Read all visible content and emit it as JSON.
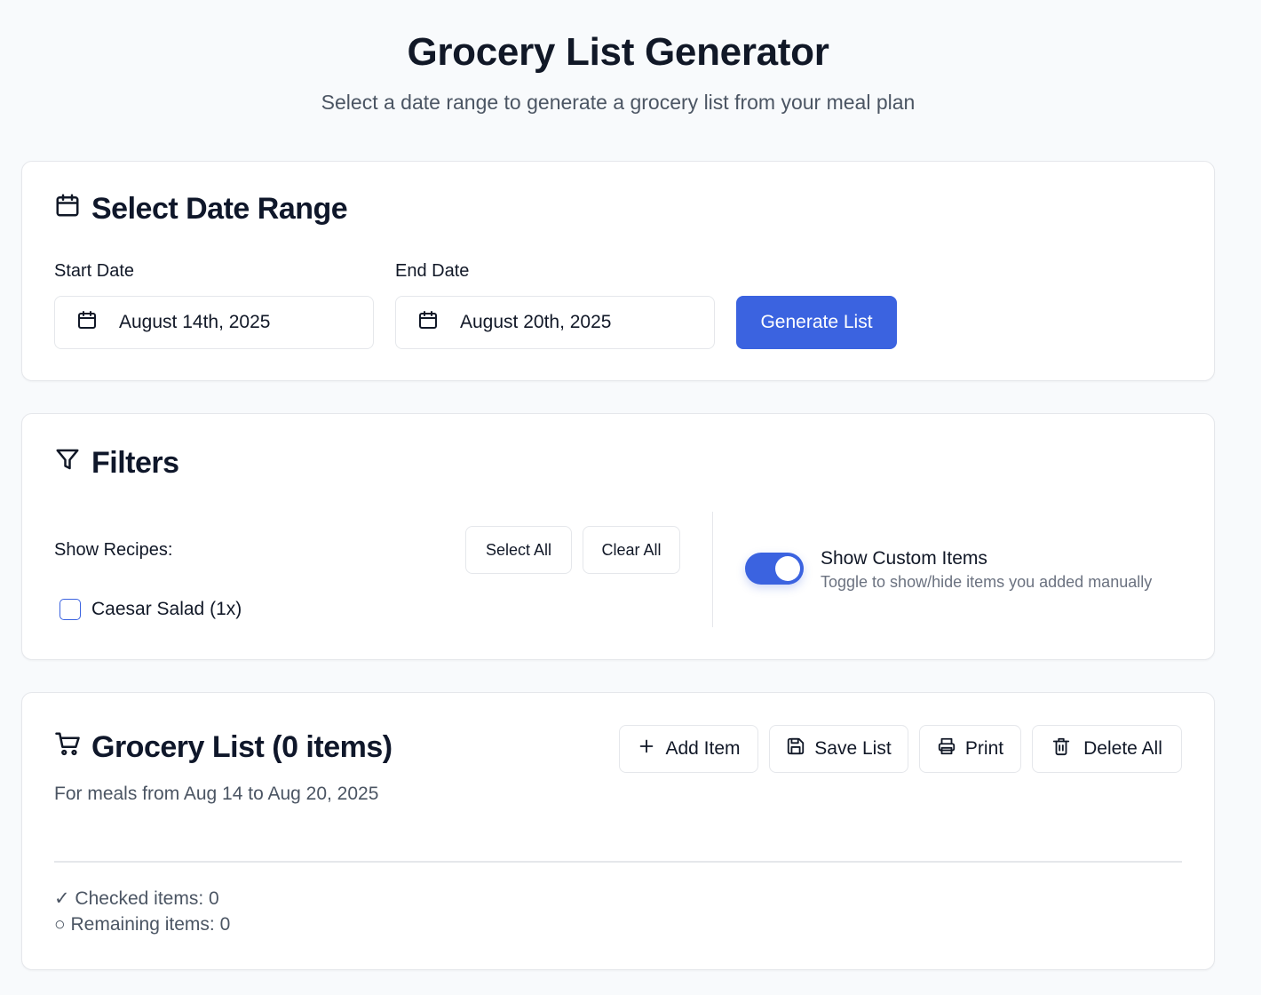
{
  "header": {
    "title": "Grocery List Generator",
    "subtitle": "Select a date range to generate a grocery list from your meal plan"
  },
  "date_range": {
    "title": "Select Date Range",
    "start_label": "Start Date",
    "start_value": "August 14th, 2025",
    "end_label": "End Date",
    "end_value": "August 20th, 2025",
    "generate_label": "Generate List"
  },
  "filters": {
    "title": "Filters",
    "show_recipes_label": "Show Recipes:",
    "select_all_label": "Select All",
    "clear_all_label": "Clear All",
    "recipes": [
      {
        "label": "Caesar Salad (1x)",
        "checked": false
      }
    ],
    "custom_items": {
      "label": "Show Custom Items",
      "description": "Toggle to show/hide items you added manually",
      "enabled": true
    }
  },
  "grocery": {
    "title": "Grocery List (0 items)",
    "subtitle": "For meals from Aug 14 to Aug 20, 2025",
    "add_item_label": "Add Item",
    "save_list_label": "Save List",
    "print_label": "Print",
    "delete_all_label": "Delete All",
    "checked_text": "✓ Checked items: 0",
    "remaining_text": "○ Remaining items: 0"
  },
  "colors": {
    "accent": "#3b63e0",
    "background": "#f8fafc",
    "border": "#e5e7eb"
  }
}
